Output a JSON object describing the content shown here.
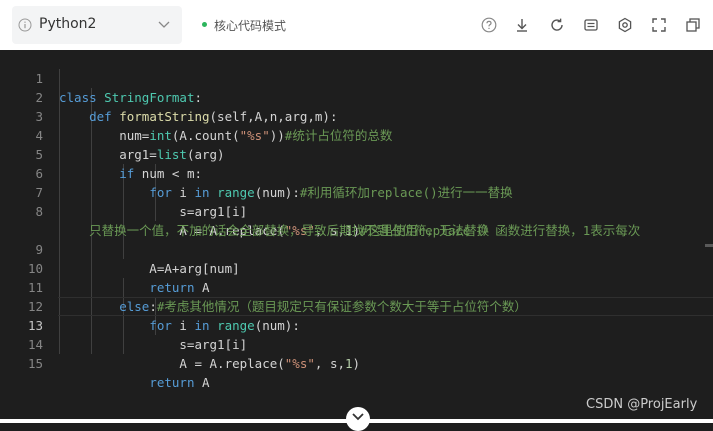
{
  "toolbar": {
    "language": "Python2",
    "mode_label": "核心代码模式",
    "mode_dot_color": "#2db55d",
    "icons": [
      "help-icon",
      "download-icon",
      "refresh-icon",
      "keyboard-icon",
      "gear-icon",
      "fullscreen-icon",
      "copy-icon"
    ]
  },
  "editor": {
    "active_line": 13,
    "lines": [
      {
        "n": "1",
        "text": "class StringFormat:"
      },
      {
        "n": "2",
        "text": "    def formatString(self,A,n,arg,m):"
      },
      {
        "n": "3",
        "text": "        num=int(A.count(\"%s\"))#统计占位符的总数"
      },
      {
        "n": "4",
        "text": "        arg1=list(arg)"
      },
      {
        "n": "5",
        "text": "        if num < m:"
      },
      {
        "n": "6",
        "text": "            for i in range(num):#利用循环加replace()进行一一替换"
      },
      {
        "n": "7",
        "text": "                s=arg1[i]"
      },
      {
        "n": "8",
        "text": "                A = A.replace(\"%s\", s,1)#这里使用replace（）函数进行替换，1表示每次"
      },
      {
        "n": "",
        "text": "只替换一个值，不加的话会全部替换，导致后期找不到占位符，无法替换"
      },
      {
        "n": "9",
        "text": "            A=A+arg[num]"
      },
      {
        "n": "10",
        "text": "            return A"
      },
      {
        "n": "11",
        "text": "        else:#考虑其他情况（题目规定只有保证参数个数大于等于占位符个数）"
      },
      {
        "n": "12",
        "text": "            for i in range(num):"
      },
      {
        "n": "13",
        "text": "                s=arg1[i]"
      },
      {
        "n": "14",
        "text": "                A = A.replace(\"%s\", s,1)"
      },
      {
        "n": "15",
        "text": "            return A"
      }
    ]
  },
  "watermark": "CSDN @ProjEarly",
  "colors": {
    "editor_bg": "#1e1e1e",
    "keyword": "#569cd6",
    "function": "#dcdcaa",
    "builtin": "#4ec9b0",
    "string": "#ce9178",
    "comment": "#6a9955",
    "text": "#d4d4d4"
  }
}
